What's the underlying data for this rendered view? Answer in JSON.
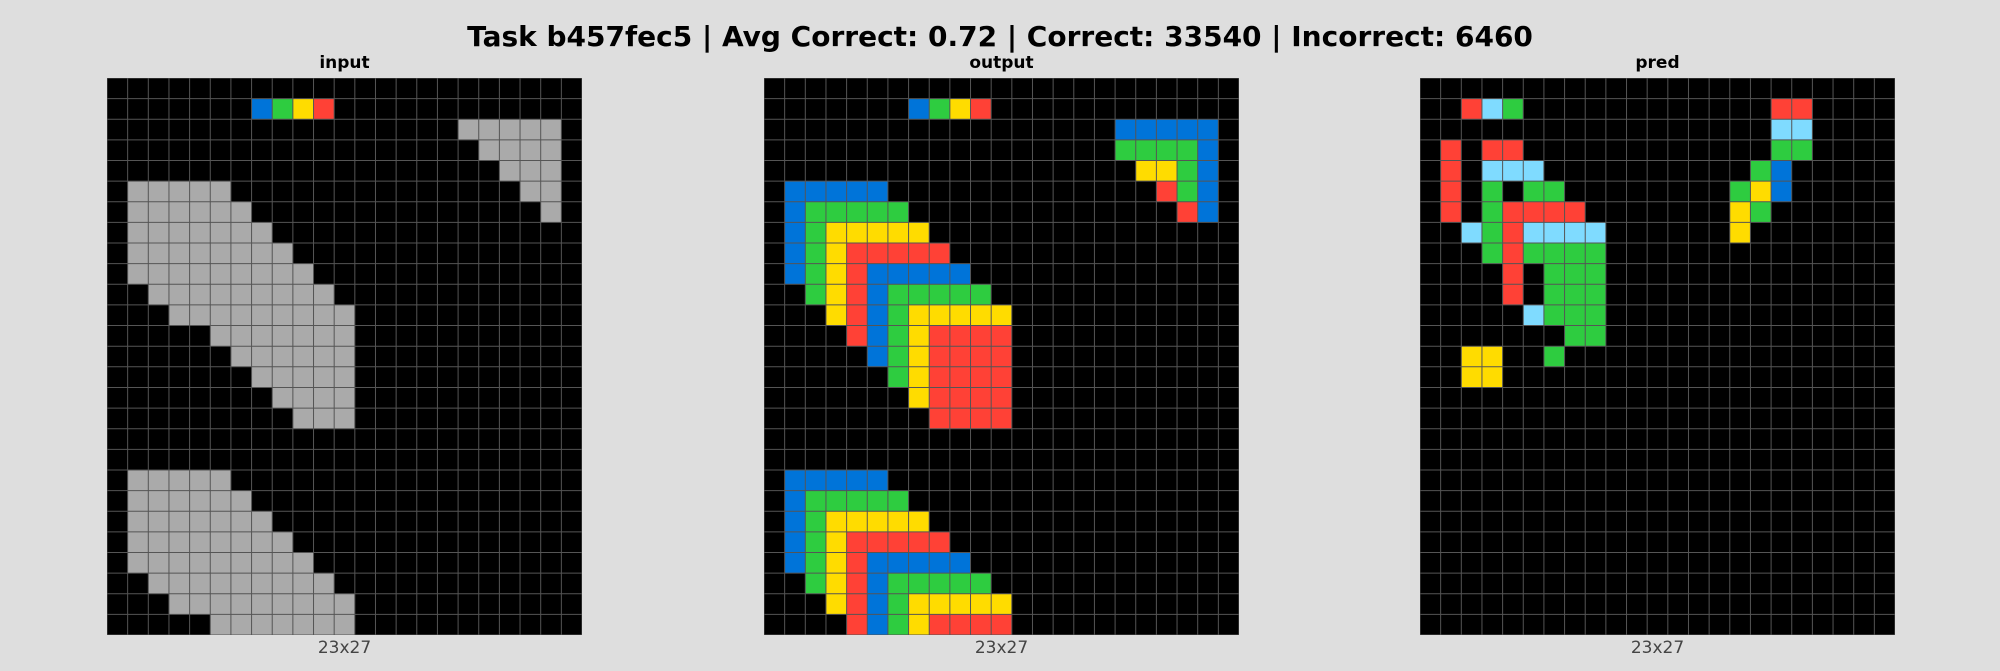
{
  "title": "Task b457fec5 | Avg Correct: 0.72 | Correct: 33540 | Incorrect: 6460",
  "palette": {
    "0": "#000000",
    "1": "#0074D9",
    "2": "#FF4136",
    "3": "#2ECC40",
    "4": "#FFDC00",
    "5": "#AAAAAA",
    "8": "#7FDBFF"
  },
  "grid_line_color": "#555555",
  "panels": [
    {
      "name": "input",
      "label": "input",
      "dims": "23x27",
      "rows": [
        "00000000000000000000000",
        "00000001342000000000000",
        "00000000000000000555550",
        "00000000000000000055550",
        "00000000000000000005550",
        "05555500000000000000550",
        "05555550000000000000050",
        "05555555000000000000000",
        "05555555500000000000000",
        "05555555550000000000000",
        "00555555555000000000000",
        "00055555555500000000000",
        "00000555555500000000000",
        "00000055555500000000000",
        "00000005555500000000000",
        "00000000555500000000000",
        "00000000055500000000000",
        "00000000000000000000000",
        "00000000000000000000000",
        "05555500000000000000000",
        "05555550000000000000000",
        "05555555000000000000000",
        "05555555500000000000000",
        "05555555550000000000000",
        "00555555555000000000000",
        "00055555555500000000000",
        "00000555555500000000000"
      ]
    },
    {
      "name": "output",
      "label": "output",
      "dims": "23x27",
      "rows": [
        "00000000000000000000000",
        "00000001342000000000000",
        "00000000000000000111110",
        "00000000000000000333310",
        "00000000000000000044310",
        "01111100000000000002310",
        "01333330000000000000210",
        "01344444000000000000000",
        "01342222200000000000000",
        "01342111110000000000000",
        "00342133333000000000000",
        "00042134444400000000000",
        "00002134222200000000000",
        "00000134222200000000000",
        "00000034222200000000000",
        "00000004222200000000000",
        "00000000222200000000000",
        "00000000000000000000000",
        "00000000000000000000000",
        "01111100000000000000000",
        "01333330000000000000000",
        "01344444000000000000000",
        "01342222200000000000000",
        "01342111110000000000000",
        "00342133333000000000000",
        "00042134444400000000000",
        "00002134222200000000000"
      ]
    },
    {
      "name": "pred",
      "label": "pred",
      "dims": "23x27",
      "rows": [
        "00000000000000000000000",
        "00283000000000000220000",
        "00000000000000000880000",
        "02022000000000000330000",
        "02088800000000003100000",
        "02030330000000034100000",
        "02032222000000043000000",
        "00832888800000040000000",
        "00032333300000000000000",
        "00002033300000000000000",
        "00002033300000000000000",
        "00000833300000000000000",
        "00000003300000000000000",
        "00440030000000000000000",
        "00440000000000000000000",
        "00000000000000000000000",
        "00000000000000000000000",
        "00000000000000000000000",
        "00000000000000000000000",
        "00000000000000000000000",
        "00000000000000000000000",
        "00000000000000000000000",
        "00000000000000000000000",
        "00000000000000000000000",
        "00000000000000000000000",
        "00000000000000000000000",
        "00000000000000000000000"
      ]
    }
  ]
}
